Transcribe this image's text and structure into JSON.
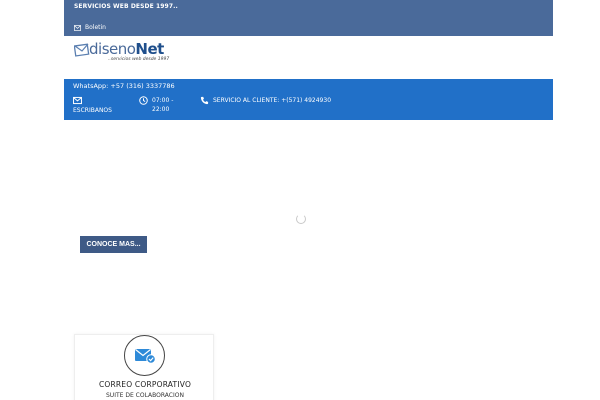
{
  "topbar": {
    "tagline": "SERVICIOS WEB DESDE 1997..",
    "boletin_label": "Boletin",
    "boletin_icon": "envelope-icon"
  },
  "logo": {
    "brand_light": "diseno",
    "brand_bold": "Net",
    "slogan": "..servicios web desde 1997"
  },
  "contact_bar": {
    "whatsapp": "WhatsApp: +57 (316) 3337786",
    "items": [
      {
        "icon": "envelope-icon",
        "label": "ESCRIBANOS"
      },
      {
        "icon": "clock-icon",
        "label": "07:00 - 22:00"
      },
      {
        "icon": "phone-icon",
        "label": "SERVICIO AL CLIENTE: +(571) 4924930"
      }
    ]
  },
  "hero": {
    "cta_label": "CONOCE MAS..."
  },
  "service_card": {
    "icon": "mail-check-icon",
    "title": "CORREO CORPORATIVO",
    "subtitle": "SUITE DE COLABORACION"
  },
  "colors": {
    "topbar": "#4a6a9a",
    "contact_bar": "#2170c8",
    "cta_button": "#3e5a86",
    "icon_accent": "#2e8ad8"
  }
}
